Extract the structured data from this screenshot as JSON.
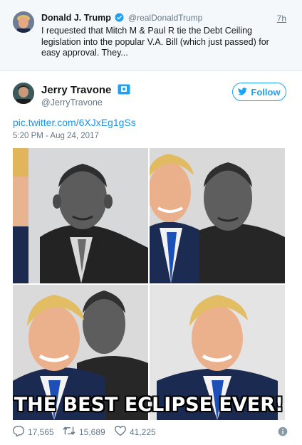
{
  "quoted_tweet": {
    "name": "Donald J. Trump",
    "handle": "@realDonaldTrump",
    "time": "7h",
    "text": "I requested that Mitch M & Paul R tie the Debt Ceiling legislation into the popular V.A. Bill (which just passed) for easy approval. They..."
  },
  "tweet": {
    "name": "Jerry Travone",
    "handle": "@JerryTravone",
    "follow_label": "Follow",
    "link": "pic.twitter.com/6XJxEg1gSs",
    "datetime": "5:20 PM - Aug 24, 2017",
    "image_caption": "THE BEST ECLIPSE EVER!"
  },
  "actions": {
    "replies": "17,565",
    "retweets": "15,689",
    "likes": "41,225"
  },
  "colors": {
    "accent": "#1da1f2",
    "link": "#1b95e0",
    "muted": "#657786"
  }
}
